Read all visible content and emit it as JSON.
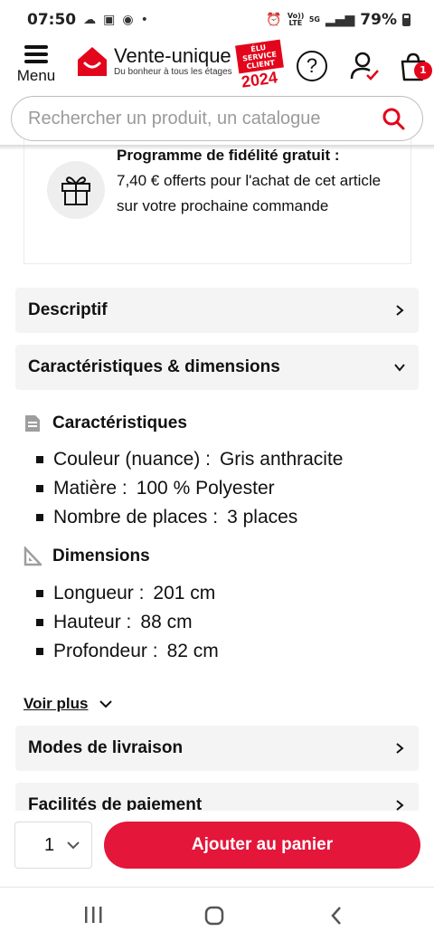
{
  "status_bar": {
    "time": "07:50",
    "signal_label_1": "Vo)) LTE",
    "signal_label_2": "5G",
    "battery": "79%"
  },
  "header": {
    "menu_label": "Menu",
    "logo_name": "Vente-unique",
    "logo_tagline": "Du bonheur à tous les étages",
    "award_text": "ÉLU SERVICE CLIENT",
    "award_year": "2024",
    "cart_count": "1"
  },
  "search": {
    "placeholder": "Rechercher un produit, un catalogue"
  },
  "loyalty": {
    "title": "Programme de fidélité gratuit :",
    "body": "7,40 € offerts pour l'achat de cet article sur votre prochaine commande"
  },
  "accordions": {
    "descriptif": "Descriptif",
    "caracteristiques": "Caractéristiques & dimensions",
    "livraison": "Modes de livraison",
    "paiement": "Facilités de paiement"
  },
  "characteristics": {
    "title": "Caractéristiques",
    "items": [
      {
        "label": "Couleur (nuance) :",
        "value": "Gris anthracite"
      },
      {
        "label": "Matière :",
        "value": "100 % Polyester"
      },
      {
        "label": "Nombre de places :",
        "value": "3 places"
      }
    ]
  },
  "dimensions": {
    "title": "Dimensions",
    "items": [
      {
        "label": "Longueur :",
        "value": "201 cm"
      },
      {
        "label": "Hauteur :",
        "value": "88 cm"
      },
      {
        "label": "Profondeur :",
        "value": "82 cm"
      }
    ]
  },
  "voir_plus": "Voir plus",
  "purchase": {
    "quantity": "1",
    "add_to_cart": "Ajouter au panier"
  },
  "colors": {
    "brand_red": "#e3051b",
    "button_red": "#e4163a"
  }
}
